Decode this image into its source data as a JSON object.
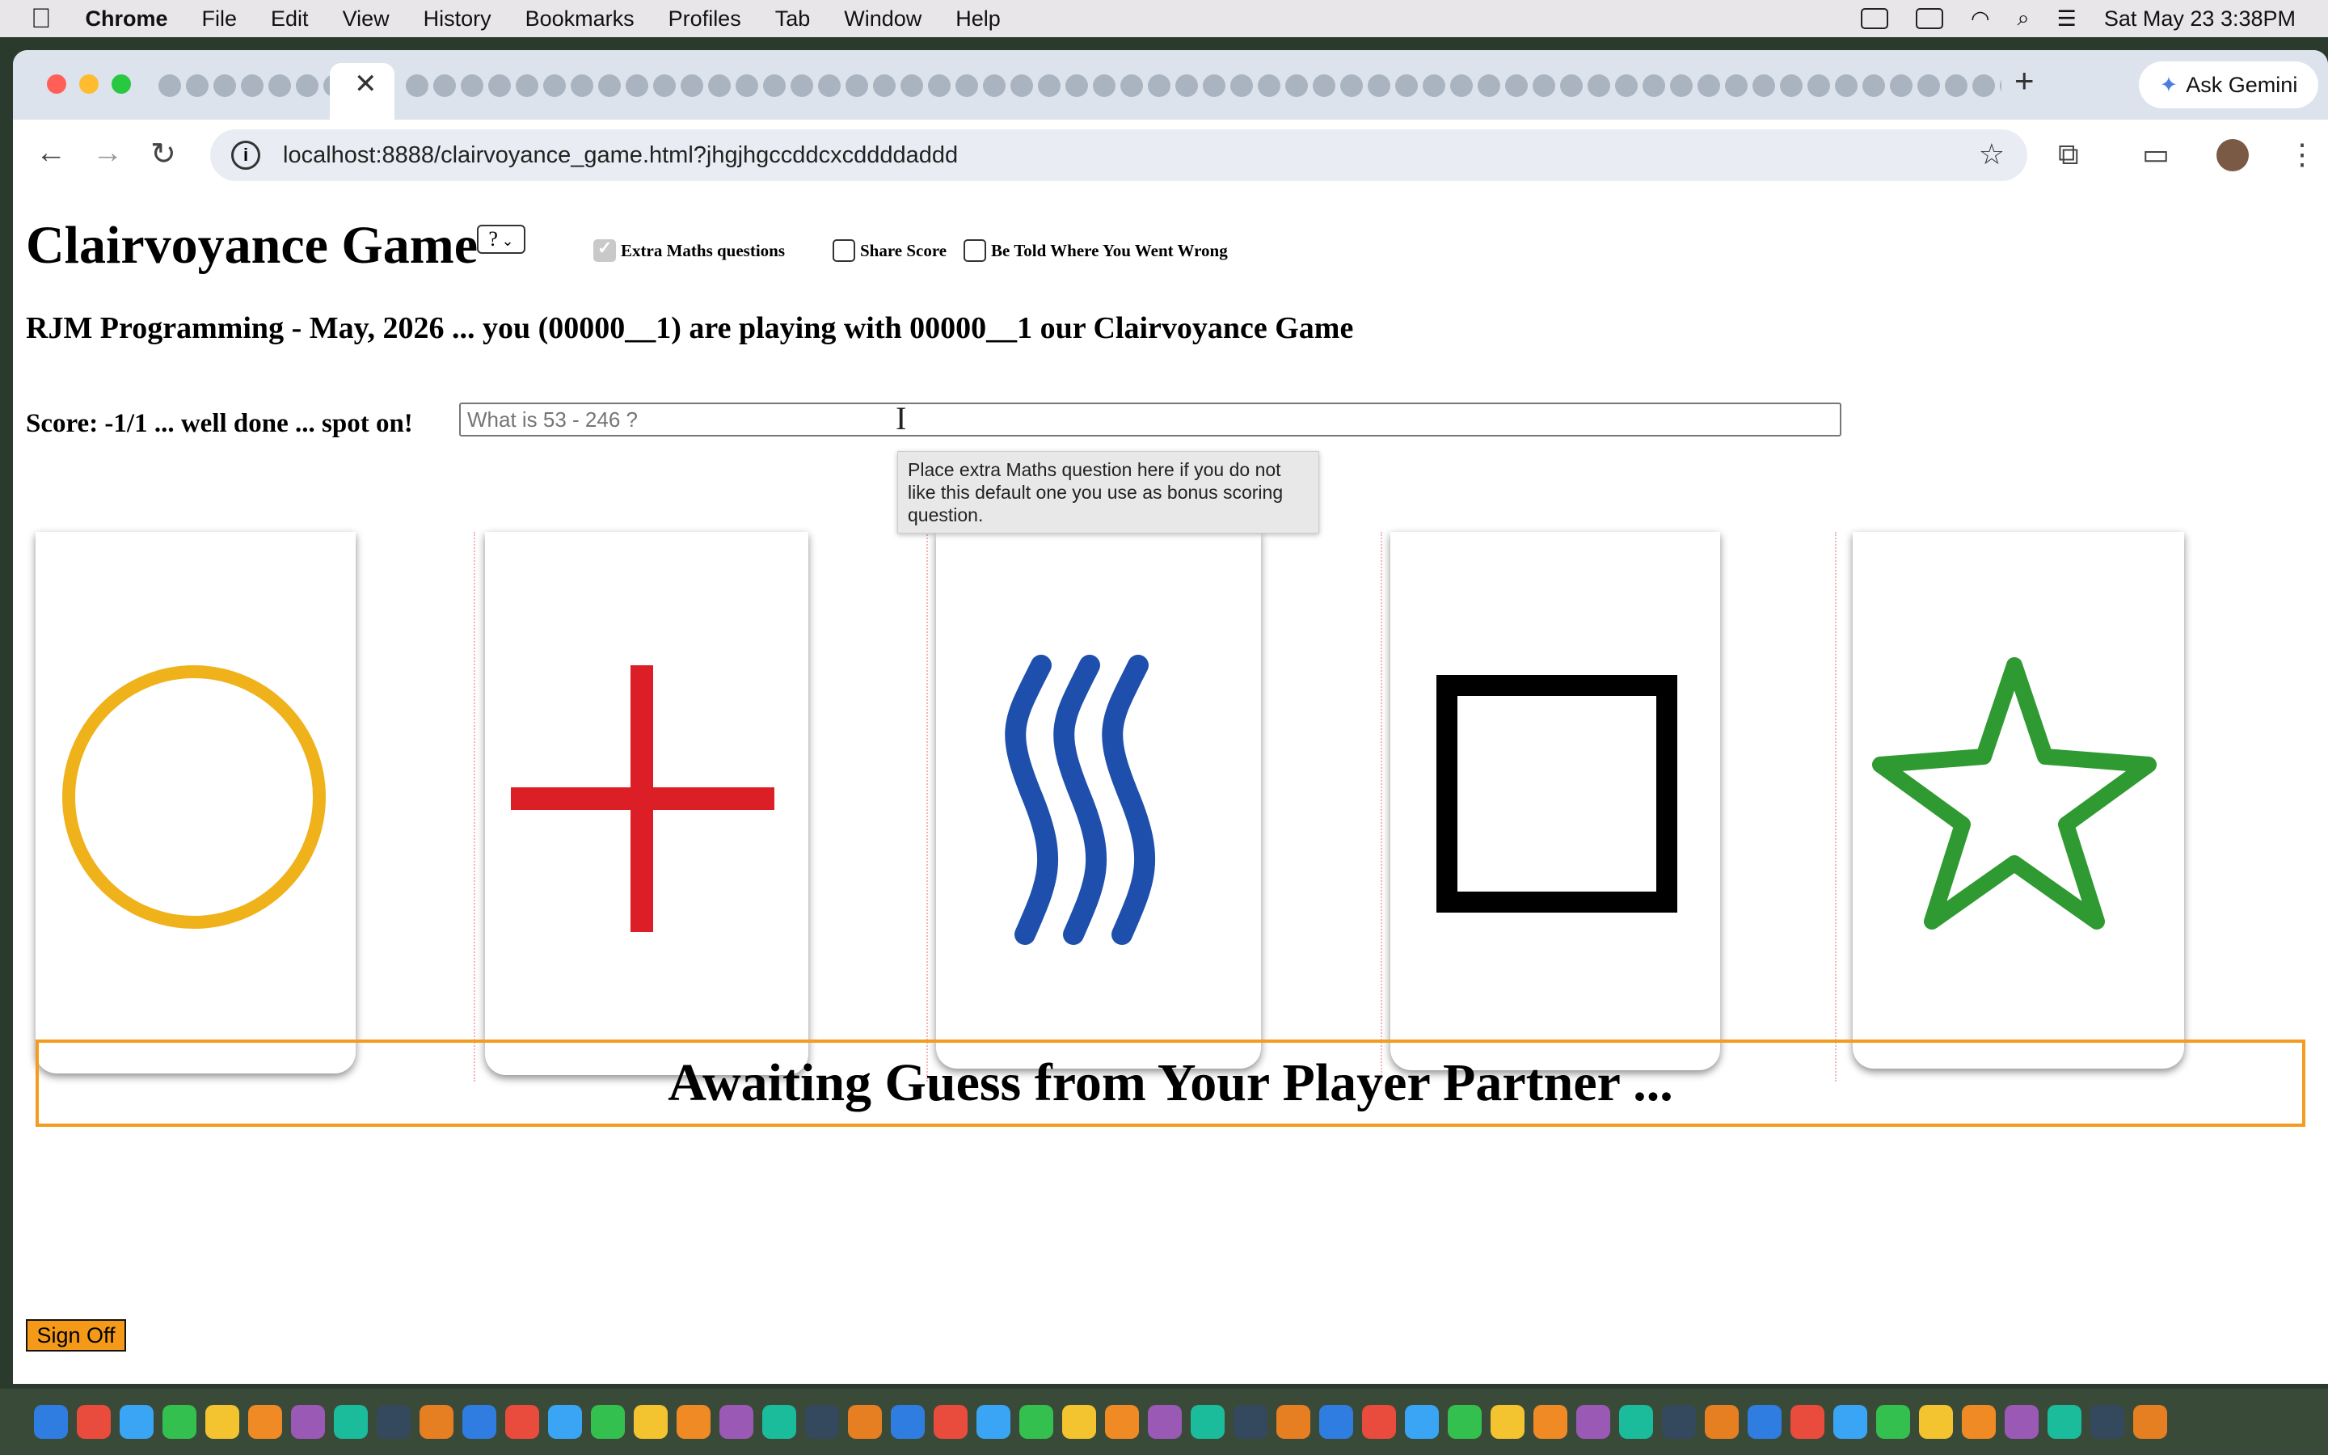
{
  "menubar": {
    "app": "Chrome",
    "items": [
      "File",
      "Edit",
      "View",
      "History",
      "Bookmarks",
      "Profiles",
      "Tab",
      "Window",
      "Help"
    ],
    "datetime": "Sat May 23  3:38PM"
  },
  "browser": {
    "url": "localhost:8888/clairvoyance_game.html?jhgjhgccddcxcddddaddd",
    "ask_gemini": "Ask Gemini"
  },
  "page": {
    "title": "Clairvoyance Game",
    "help_select": "?",
    "options": {
      "extra_maths": "Extra Maths questions",
      "share_score": "Share Score",
      "be_told": "Be Told Where You Went Wrong"
    },
    "subtitle": "RJM Programming - May, 2026 ... you (00000__1) are playing with 00000__1 our Clairvoyance Game",
    "score": "Score: -1/1 ... well done ... spot on!",
    "maths_placeholder": "What is 53 - 246 ?",
    "tooltip": "Place extra Maths question here if you do not like this default one you use as bonus scoring question.",
    "cards": [
      "circle",
      "cross",
      "waves",
      "square",
      "star"
    ],
    "card_colors": {
      "circle": "#f0b21a",
      "cross": "#dc1f26",
      "waves": "#1e4fad",
      "square": "#000000",
      "star": "#2f9a32"
    },
    "awaiting": "Awaiting Guess from Your Player Partner ...",
    "sign_off": "Sign Off"
  }
}
